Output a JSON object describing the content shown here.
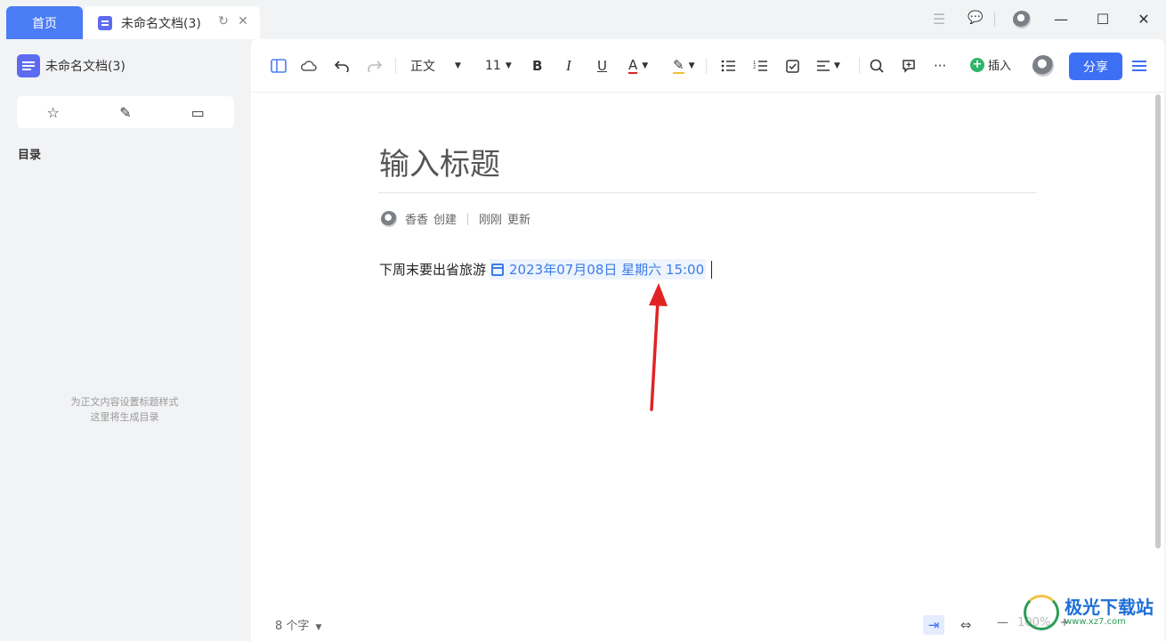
{
  "titlebar": {
    "home_tab": "首页",
    "doc_tab": "未命名文档(3)",
    "refresh_icon": "↻",
    "close_tab_icon": "✕",
    "list_icon": "☰",
    "chat_icon": "💬",
    "minimize_icon": "—",
    "maximize_icon": "☐",
    "close_icon": "✕"
  },
  "sidebar": {
    "doc_name": "未命名文档(3)",
    "toc_label": "目录",
    "empty_hint_line1": "为正文内容设置标题样式",
    "empty_hint_line2": "这里将生成目录",
    "tools": [
      "☆",
      "✎",
      "▭"
    ]
  },
  "toolbar": {
    "style_select": "正文",
    "font_size": "11",
    "bold": "B",
    "italic": "I",
    "underline": "U",
    "font_color": "A",
    "highlight": "✎",
    "more": "···",
    "insert_label": "插入",
    "share_label": "分享"
  },
  "document": {
    "title_placeholder": "输入标题",
    "creator": "香香",
    "created_label": "创建",
    "updated_time": "刚刚",
    "updated_label": "更新",
    "body_text": "下周末要出省旅游",
    "date_chip": "2023年07月08日 星期六 15:00"
  },
  "footer": {
    "word_count": "8 个字",
    "zoom_label": "100%",
    "zoom_out": "—",
    "zoom_in": "+"
  },
  "watermark": {
    "main": "极光下载站",
    "sub": "www.xz7.com"
  },
  "colors": {
    "accent": "#4a7df5",
    "share_button": "#3d6ff5",
    "date_link": "#3c7ce6",
    "annotation_arrow": "#e02424"
  }
}
